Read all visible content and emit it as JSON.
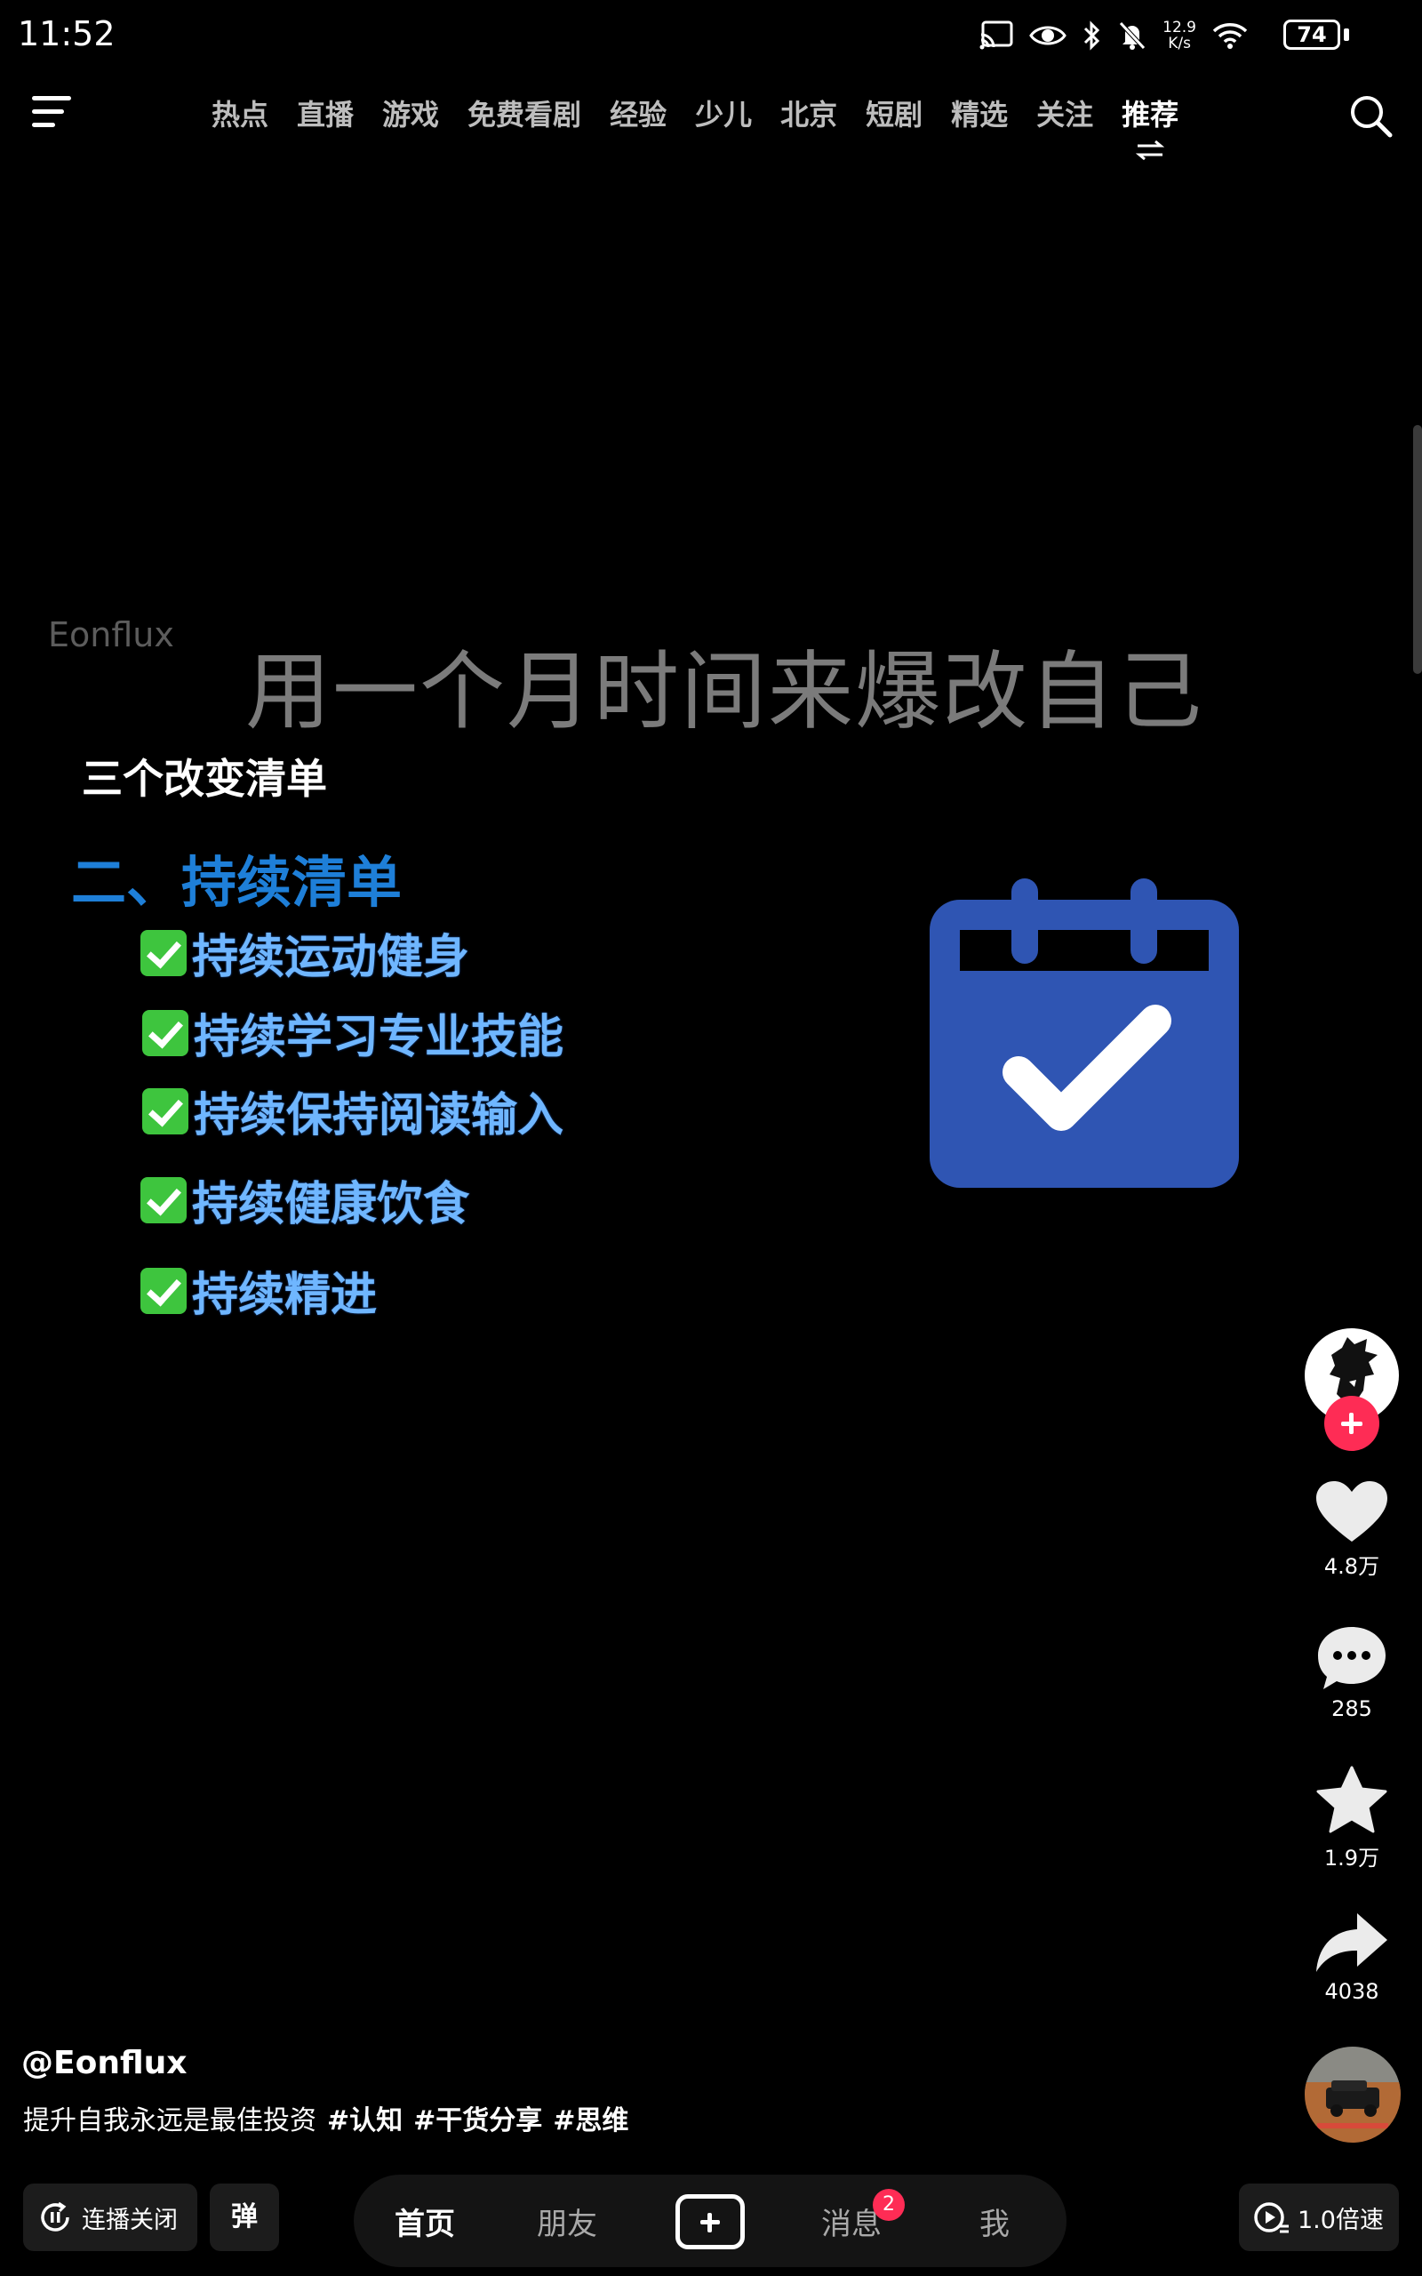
{
  "status_bar": {
    "time": "11:52",
    "net_speed_value": "12.9",
    "net_speed_unit": "K/s",
    "battery": "74"
  },
  "top_nav": {
    "tabs": [
      "热点",
      "直播",
      "游戏",
      "免费看剧",
      "经验",
      "少儿",
      "北京",
      "短剧",
      "精选",
      "关注",
      "推荐"
    ],
    "active_tab": "推荐"
  },
  "video": {
    "watermark": "Eonflux",
    "title": "用一个月时间来爆改自己",
    "list_heading": "三个改变清单",
    "section_heading": "二、持续清单",
    "items": [
      "持续运动健身",
      "持续学习专业技能",
      "持续保持阅读输入",
      "持续健康饮食",
      "持续精进"
    ]
  },
  "sidebar": {
    "likes": "4.8万",
    "comments": "285",
    "favorites": "1.9万",
    "shares": "4038"
  },
  "caption": {
    "author": "@Eonflux",
    "text": "提升自我永远是最佳投资",
    "tags": [
      "#认知",
      "#干货分享",
      "#思维"
    ]
  },
  "bottom_bar": {
    "autoplay_label": "连播关闭",
    "danmaku_label": "弹",
    "tabs": [
      "首页",
      "朋友",
      "消息",
      "我"
    ],
    "message_badge": "2",
    "speed_label": "1.0倍速"
  },
  "colors": {
    "accent_red": "#fe2c55",
    "heading_blue": "#1e7fd8",
    "calendar_blue": "#2f55b3",
    "check_green": "#3ec53e"
  }
}
